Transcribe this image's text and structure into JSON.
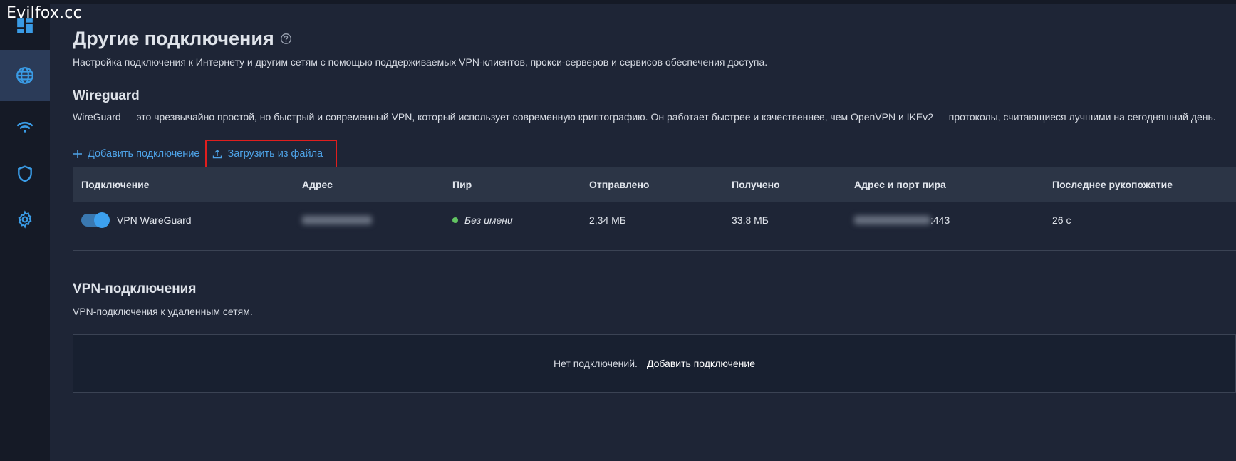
{
  "watermark": "Evilfox.cc",
  "sidebar": {
    "items": [
      {
        "icon": "dashboard-icon"
      },
      {
        "icon": "globe-icon",
        "active": true
      },
      {
        "icon": "wifi-icon"
      },
      {
        "icon": "shield-icon"
      },
      {
        "icon": "gear-icon"
      }
    ]
  },
  "page": {
    "title": "Другие подключения",
    "description": "Настройка подключения к Интернету и другим сетям с помощью поддерживаемых VPN-клиентов, прокси-серверов и сервисов обеспечения доступа."
  },
  "wireguard": {
    "title": "Wireguard",
    "description": "WireGuard — это чрезвычайно простой, но быстрый и современный VPN, который использует современную криптографию. Он работает быстрее и качественнее, чем OpenVPN и IKEv2 — протоколы, считающиеся лучшими на сегодняшний день.",
    "add_label": "Добавить подключение",
    "upload_label": "Загрузить из файла",
    "columns": [
      "Подключение",
      "Адрес",
      "Пир",
      "Отправлено",
      "Получено",
      "Адрес и порт пира",
      "Последнее рукопожатие"
    ],
    "rows": [
      {
        "enabled": true,
        "name": "VPN WareGuard",
        "peer": "Без имени",
        "peer_status_color": "#62c462",
        "sent": "2,34 МБ",
        "received": "33,8 МБ",
        "peer_port": ":443",
        "handshake": "26 с"
      }
    ]
  },
  "vpn": {
    "title": "VPN-подключения",
    "description": "VPN-подключения к удаленным сетям.",
    "empty_text": "Нет подключений.",
    "empty_link": "Добавить подключение"
  },
  "colors": {
    "accent": "#4ea3e8",
    "highlight_box": "#e01e1e",
    "background": "#1e2536",
    "sidebar": "#151a26"
  }
}
